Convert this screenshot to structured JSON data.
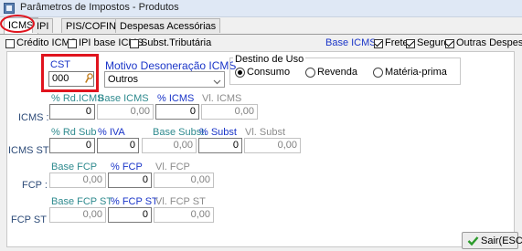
{
  "window": {
    "title": "Parâmetros de Impostos - Produtos"
  },
  "tabs": [
    "ICMS",
    "IPI",
    "PIS/COFINS",
    "Despesas Acessórias"
  ],
  "options": {
    "credito_icms": "Crédito ICMS",
    "ipi_base_icms": "IPI base ICMS",
    "subst_tributaria": "Subst.Tributária"
  },
  "base_icms": {
    "label": "Base ICMS :",
    "frete": "Frete",
    "seguro": "Seguro",
    "outras_despesas": "Outras Despesas"
  },
  "cst": {
    "label": "CST",
    "value": "000"
  },
  "motivo": {
    "label": "Motivo Desoneração ICMS",
    "value": "Outros"
  },
  "destino": {
    "legend": "Destino de Uso",
    "consumo": "Consumo",
    "revenda": "Revenda",
    "materia_prima": "Matéria-prima",
    "selected": "Consumo"
  },
  "icms": {
    "row_label": "ICMS :",
    "rd_label": "% Rd.ICMS",
    "rd": "0",
    "base_label": "Base ICMS",
    "base": "0,00",
    "pct_label": "% ICMS",
    "pct": "0",
    "vl_label": "Vl. ICMS",
    "vl": "0,00"
  },
  "icms_st": {
    "row_label": "ICMS ST :",
    "rd_label": "% Rd Sub",
    "rd": "0",
    "iva_label": "% IVA",
    "iva": "0",
    "base_label": "Base Subst.",
    "base": "0,00",
    "pct_label": "% Subst",
    "pct": "0",
    "vl_label": "Vl. Subst",
    "vl": "0,00"
  },
  "fcp": {
    "row_label": "FCP :",
    "base_label": "Base FCP",
    "base": "0,00",
    "pct_label": "% FCP",
    "pct": "0",
    "vl_label": "Vl. FCP",
    "vl": "0,00"
  },
  "fcp_st": {
    "row_label": "FCP ST :",
    "base_label": "Base FCP ST",
    "base": "0,00",
    "pct_label": "% FCP ST",
    "pct": "0",
    "vl_label": "Vl. FCP ST",
    "vl": "0,00"
  },
  "exit_button": "Sair(ESC)",
  "colors": {
    "highlight": "#e0141e",
    "blue_label": "#1a35c8",
    "teal_label": "#2e8a8e",
    "check_green": "#2a9a2a"
  }
}
